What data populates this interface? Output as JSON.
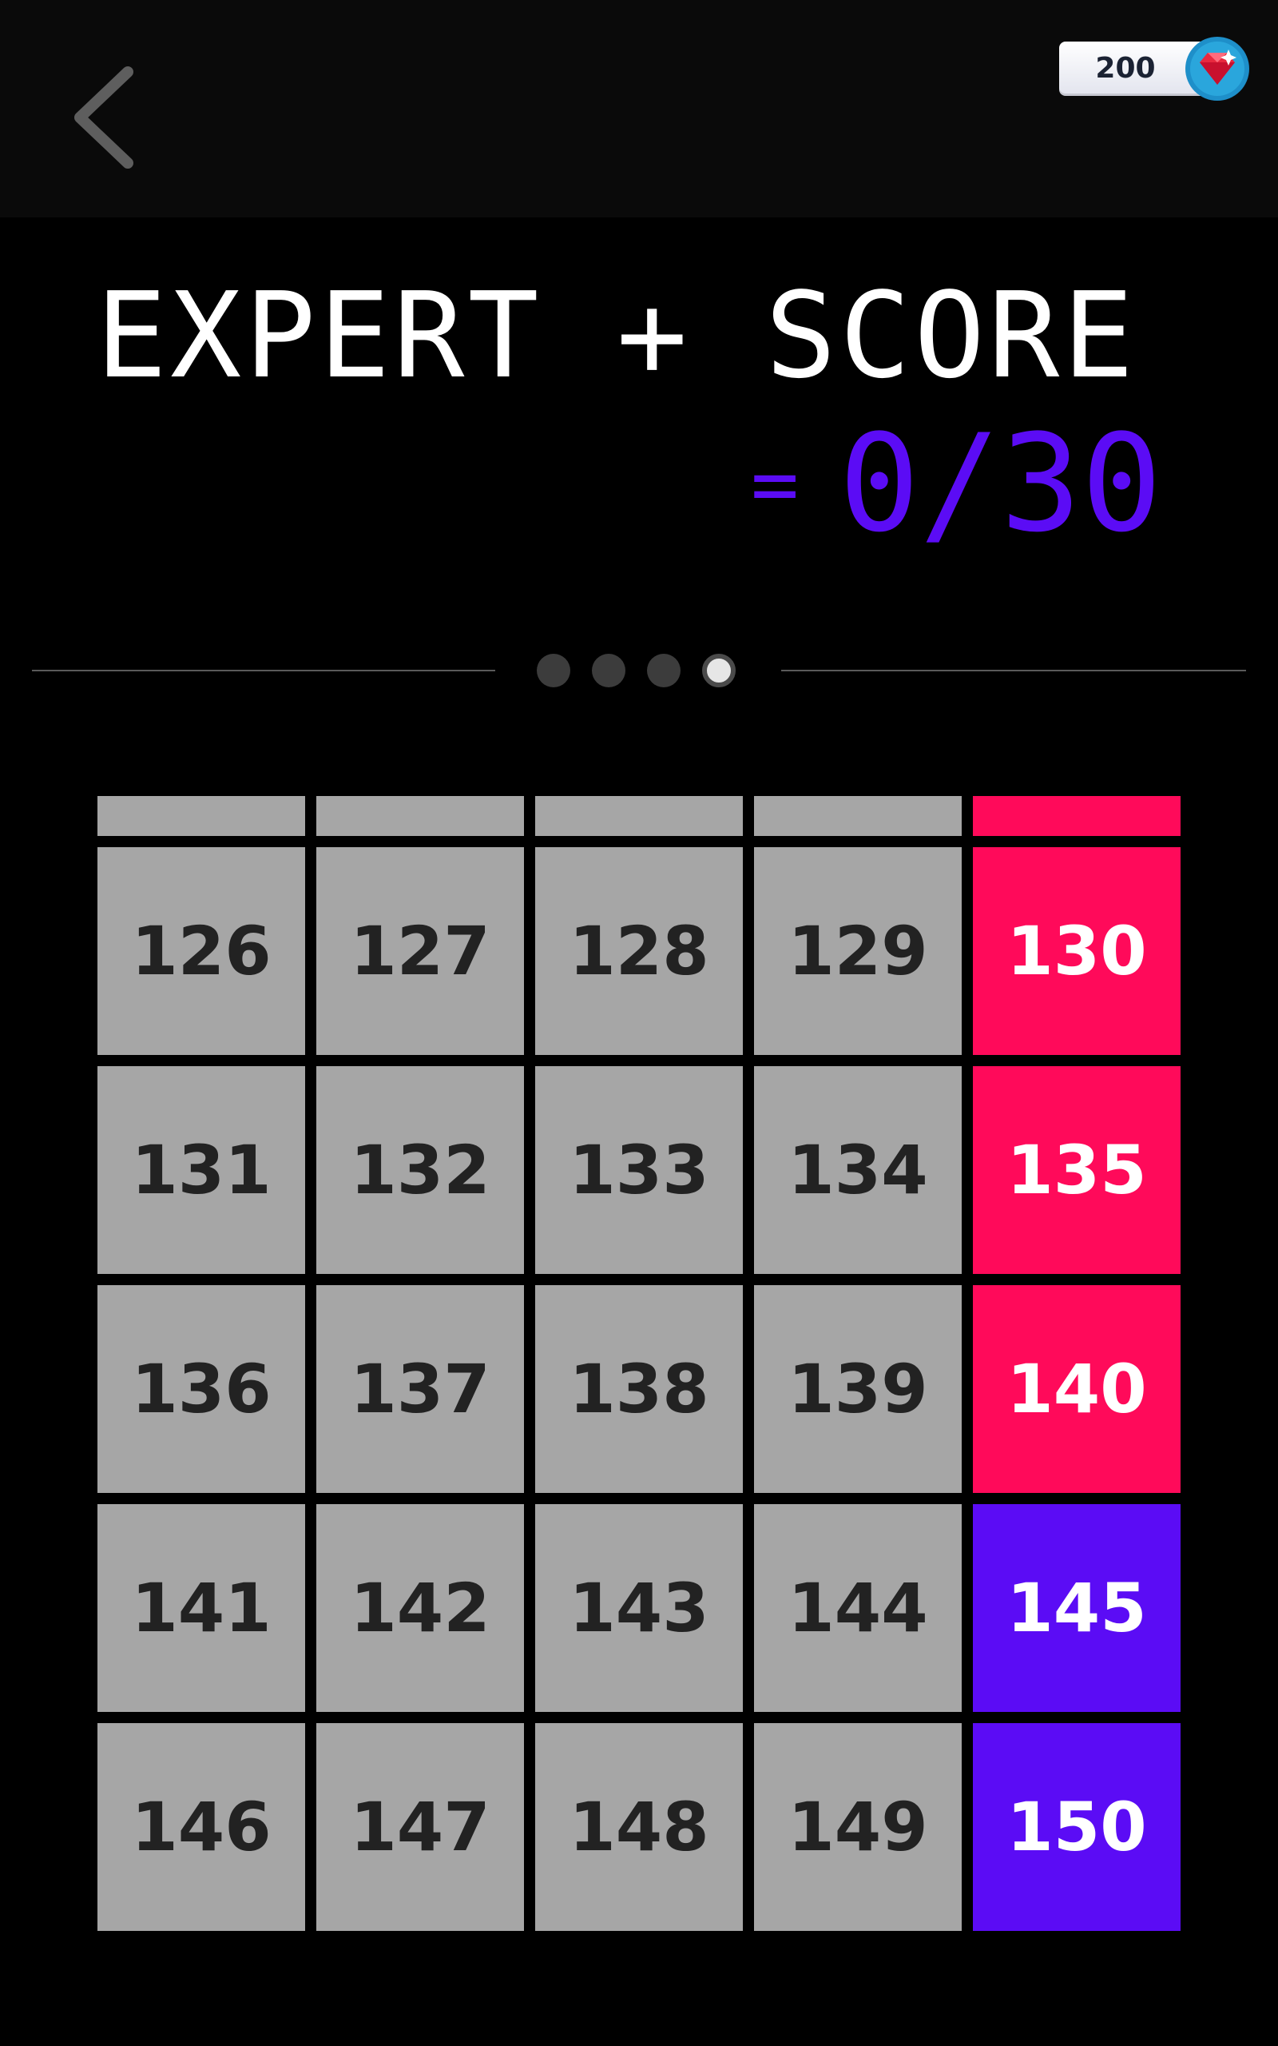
{
  "header": {
    "back_icon": "chevron-left-icon",
    "gems": {
      "value": "200",
      "icon": "gem-icon"
    }
  },
  "title": "EXPERT + SCORE",
  "score": {
    "equals": "=",
    "value": "0/30"
  },
  "pagination": {
    "pages": 4,
    "active_index": 3
  },
  "colors": {
    "grey_tile": "#a6a6a6",
    "grey_text": "#222222",
    "red_tile": "#ff0a5a",
    "purple_tile": "#5b0cf5",
    "accent_text": "#ffffff"
  },
  "partial_row": [
    "grey",
    "grey",
    "grey",
    "grey",
    "red"
  ],
  "levels": [
    {
      "label": "126",
      "color": "grey"
    },
    {
      "label": "127",
      "color": "grey"
    },
    {
      "label": "128",
      "color": "grey"
    },
    {
      "label": "129",
      "color": "grey"
    },
    {
      "label": "130",
      "color": "red"
    },
    {
      "label": "131",
      "color": "grey"
    },
    {
      "label": "132",
      "color": "grey"
    },
    {
      "label": "133",
      "color": "grey"
    },
    {
      "label": "134",
      "color": "grey"
    },
    {
      "label": "135",
      "color": "red"
    },
    {
      "label": "136",
      "color": "grey"
    },
    {
      "label": "137",
      "color": "grey"
    },
    {
      "label": "138",
      "color": "grey"
    },
    {
      "label": "139",
      "color": "grey"
    },
    {
      "label": "140",
      "color": "red"
    },
    {
      "label": "141",
      "color": "grey"
    },
    {
      "label": "142",
      "color": "grey"
    },
    {
      "label": "143",
      "color": "grey"
    },
    {
      "label": "144",
      "color": "grey"
    },
    {
      "label": "145",
      "color": "purple"
    },
    {
      "label": "146",
      "color": "grey"
    },
    {
      "label": "147",
      "color": "grey"
    },
    {
      "label": "148",
      "color": "grey"
    },
    {
      "label": "149",
      "color": "grey"
    },
    {
      "label": "150",
      "color": "purple"
    }
  ]
}
